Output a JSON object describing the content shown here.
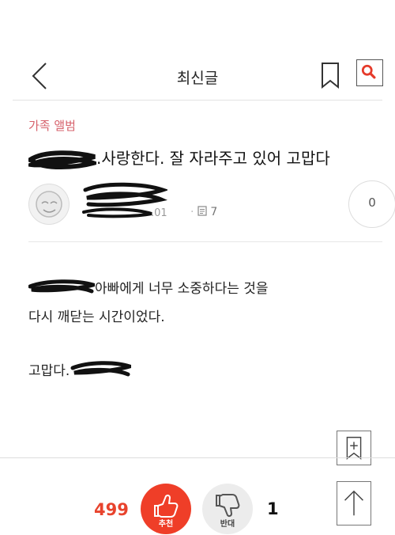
{
  "header": {
    "title": "최신글"
  },
  "post": {
    "category": "가족 앨범",
    "headline": ".사랑한다. 잘 자라주고 있어 고맙다",
    "date_fragment": ".01",
    "comment_count": "7",
    "reply_bubble": "0"
  },
  "content": {
    "line1": "아빠에게 너무 소중하다는 것을",
    "line2": "다시 깨닫는 시간이었다.",
    "line3": "고맙다."
  },
  "footer": {
    "recommend_count": "499",
    "recommend_label": "추천",
    "oppose_label": "반대",
    "oppose_count": "1"
  },
  "colors": {
    "accent": "#ef3e28",
    "category": "#d6616b"
  }
}
